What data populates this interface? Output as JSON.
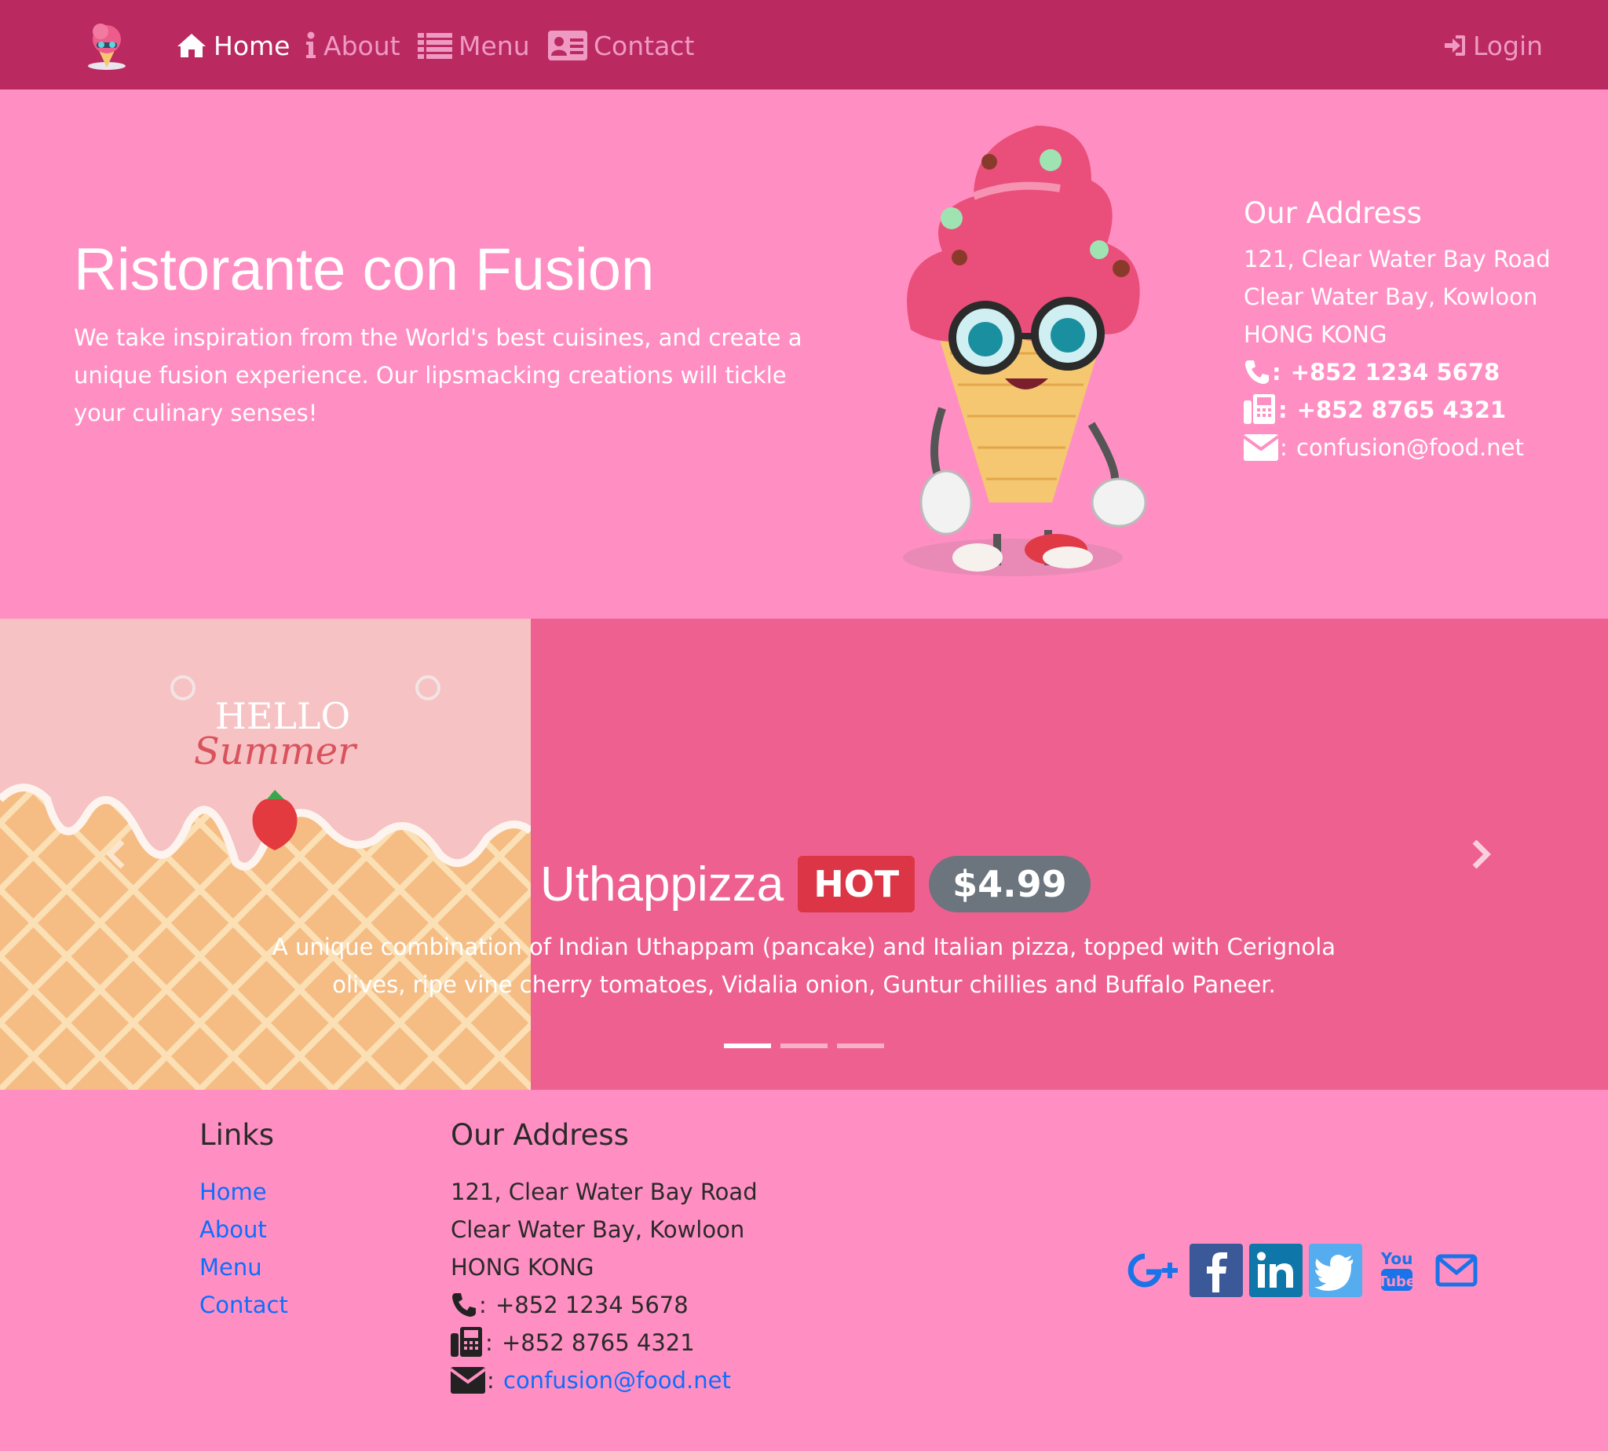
{
  "nav": {
    "items": [
      {
        "label": "Home",
        "icon": "home-icon",
        "active": true
      },
      {
        "label": "About",
        "icon": "info-icon",
        "active": false
      },
      {
        "label": "Menu",
        "icon": "list-icon",
        "active": false
      },
      {
        "label": "Contact",
        "icon": "address-card-icon",
        "active": false
      }
    ],
    "login_label": "Login"
  },
  "jumbotron": {
    "title": "Ristorante con Fusion",
    "text": "We take inspiration from the World's best cuisines, and create a unique fusion experience. Our lipsmacking creations will tickle your culinary senses!",
    "address": {
      "heading": "Our Address",
      "line1": "121, Clear Water Bay Road",
      "line2": "Clear Water Bay, Kowloon",
      "line3": "HONG KONG",
      "phone": "+852 1234 5678",
      "fax": "+852 8765 4321",
      "email": "confusion@food.net"
    }
  },
  "carousel": {
    "slide_text": {
      "hello": "HELLO",
      "summer": "Summer"
    },
    "item_name": "Uthappizza",
    "badge": "HOT",
    "price": "$4.99",
    "description": "A unique combination of Indian Uthappam (pancake) and Italian pizza, topped with Cerignola olives, ripe vine cherry tomatoes, Vidalia onion, Guntur chillies and Buffalo Paneer.",
    "indicator_count": 3,
    "active_index": 0
  },
  "footer": {
    "links_heading": "Links",
    "links": [
      "Home",
      "About",
      "Menu",
      "Contact"
    ],
    "address_heading": "Our Address",
    "line1": "121, Clear Water Bay Road",
    "line2": "Clear Water Bay, Kowloon",
    "line3": "HONG KONG",
    "phone": "+852 1234 5678",
    "fax": "+852 8765 4321",
    "email": "confusion@food.net",
    "social": [
      "google-plus-icon",
      "facebook-icon",
      "linkedin-icon",
      "twitter-icon",
      "youtube-icon",
      "envelope-icon"
    ]
  },
  "colors": {
    "navbar": "#ba2960",
    "page_bg": "#ff8fc2",
    "carousel_bg": "#ee6090",
    "badge_hot": "#dc3545",
    "badge_price": "#6c757d",
    "link": "#0d6efd"
  }
}
